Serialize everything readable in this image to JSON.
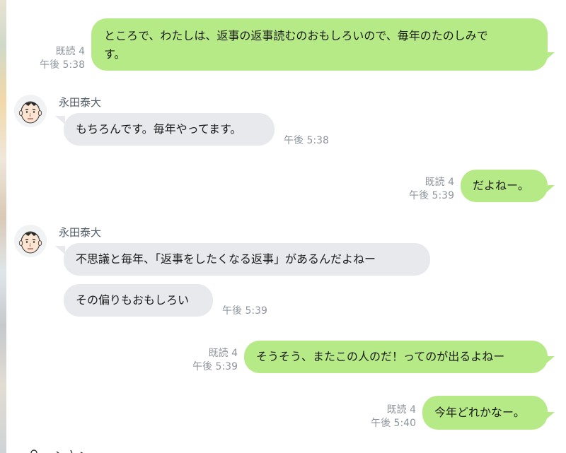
{
  "messages": [
    {
      "id": "m1",
      "side": "out",
      "lines": [
        "ところで、わたしは、返事の返事読むのおもしろいので、毎年のたのしみで",
        "す。"
      ],
      "read": "既読 4",
      "time": "午後 5:38"
    },
    {
      "id": "m2",
      "side": "in",
      "sender": "永田泰大",
      "lines": [
        "もちろんです。毎年やってます。"
      ],
      "time": "午後 5:38"
    },
    {
      "id": "m3",
      "side": "out",
      "lines": [
        "だよねー。"
      ],
      "read": "既読 4",
      "time": "午後 5:39"
    },
    {
      "id": "m4",
      "side": "in",
      "sender": "永田泰大",
      "lines": [
        "不思議と毎年、「返事をしたくなる返事」があるんだよねー"
      ]
    },
    {
      "id": "m5",
      "side": "in",
      "lines": [
        "その偏りもおもしろい"
      ],
      "time": "午後 5:39"
    },
    {
      "id": "m6",
      "side": "out",
      "lines": [
        "そうそう、またこの人のだ！ってのが出るよねー"
      ],
      "read": "既読 4",
      "time": "午後 5:39"
    },
    {
      "id": "m7",
      "side": "out",
      "lines": [
        "今年どれかなー。"
      ],
      "read": "既読 4",
      "time": "午後 5:40"
    }
  ],
  "icons": {
    "avatar": "face-avatar-icon"
  },
  "colors": {
    "outgoing_bubble": "#b6ea86",
    "incoming_bubble": "#e7e9ec",
    "meta_text": "#8f959c"
  }
}
